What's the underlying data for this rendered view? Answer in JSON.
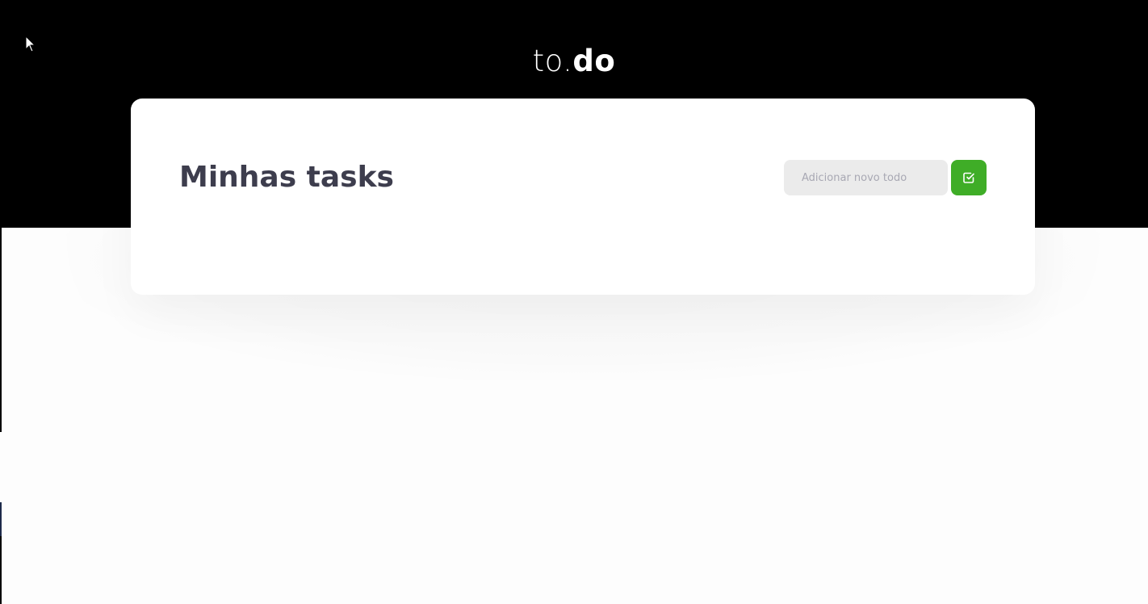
{
  "header": {
    "logo_prefix": "to.",
    "logo_suffix": "do",
    "background_color": "#000000"
  },
  "main": {
    "title": "Minhas tasks",
    "new_todo_input": {
      "placeholder": "Adicionar novo todo",
      "value": ""
    },
    "add_button": {
      "icon": "check-square-icon",
      "color": "#3fad27"
    }
  },
  "tasks": []
}
